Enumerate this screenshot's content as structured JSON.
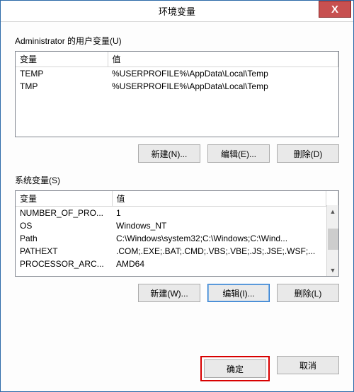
{
  "window": {
    "title": "环境变量",
    "close_label": "X"
  },
  "user_section": {
    "label": "Administrator 的用户变量(U)",
    "headers": {
      "name": "变量",
      "value": "值"
    },
    "rows": [
      {
        "name": "TEMP",
        "value": "%USERPROFILE%\\AppData\\Local\\Temp"
      },
      {
        "name": "TMP",
        "value": "%USERPROFILE%\\AppData\\Local\\Temp"
      }
    ],
    "buttons": {
      "new": "新建(N)...",
      "edit": "编辑(E)...",
      "delete": "删除(D)"
    }
  },
  "sys_section": {
    "label": "系统变量(S)",
    "headers": {
      "name": "变量",
      "value": "值"
    },
    "rows": [
      {
        "name": "NUMBER_OF_PRO...",
        "value": "1"
      },
      {
        "name": "OS",
        "value": "Windows_NT"
      },
      {
        "name": "Path",
        "value": "C:\\Windows\\system32;C:\\Windows;C:\\Wind..."
      },
      {
        "name": "PATHEXT",
        "value": ".COM;.EXE;.BAT;.CMD;.VBS;.VBE;.JS;.JSE;.WSF;..."
      },
      {
        "name": "PROCESSOR_ARC...",
        "value": "AMD64"
      }
    ],
    "buttons": {
      "new": "新建(W)...",
      "edit": "编辑(I)...",
      "delete": "删除(L)"
    }
  },
  "footer": {
    "ok": "确定",
    "cancel": "取消"
  }
}
